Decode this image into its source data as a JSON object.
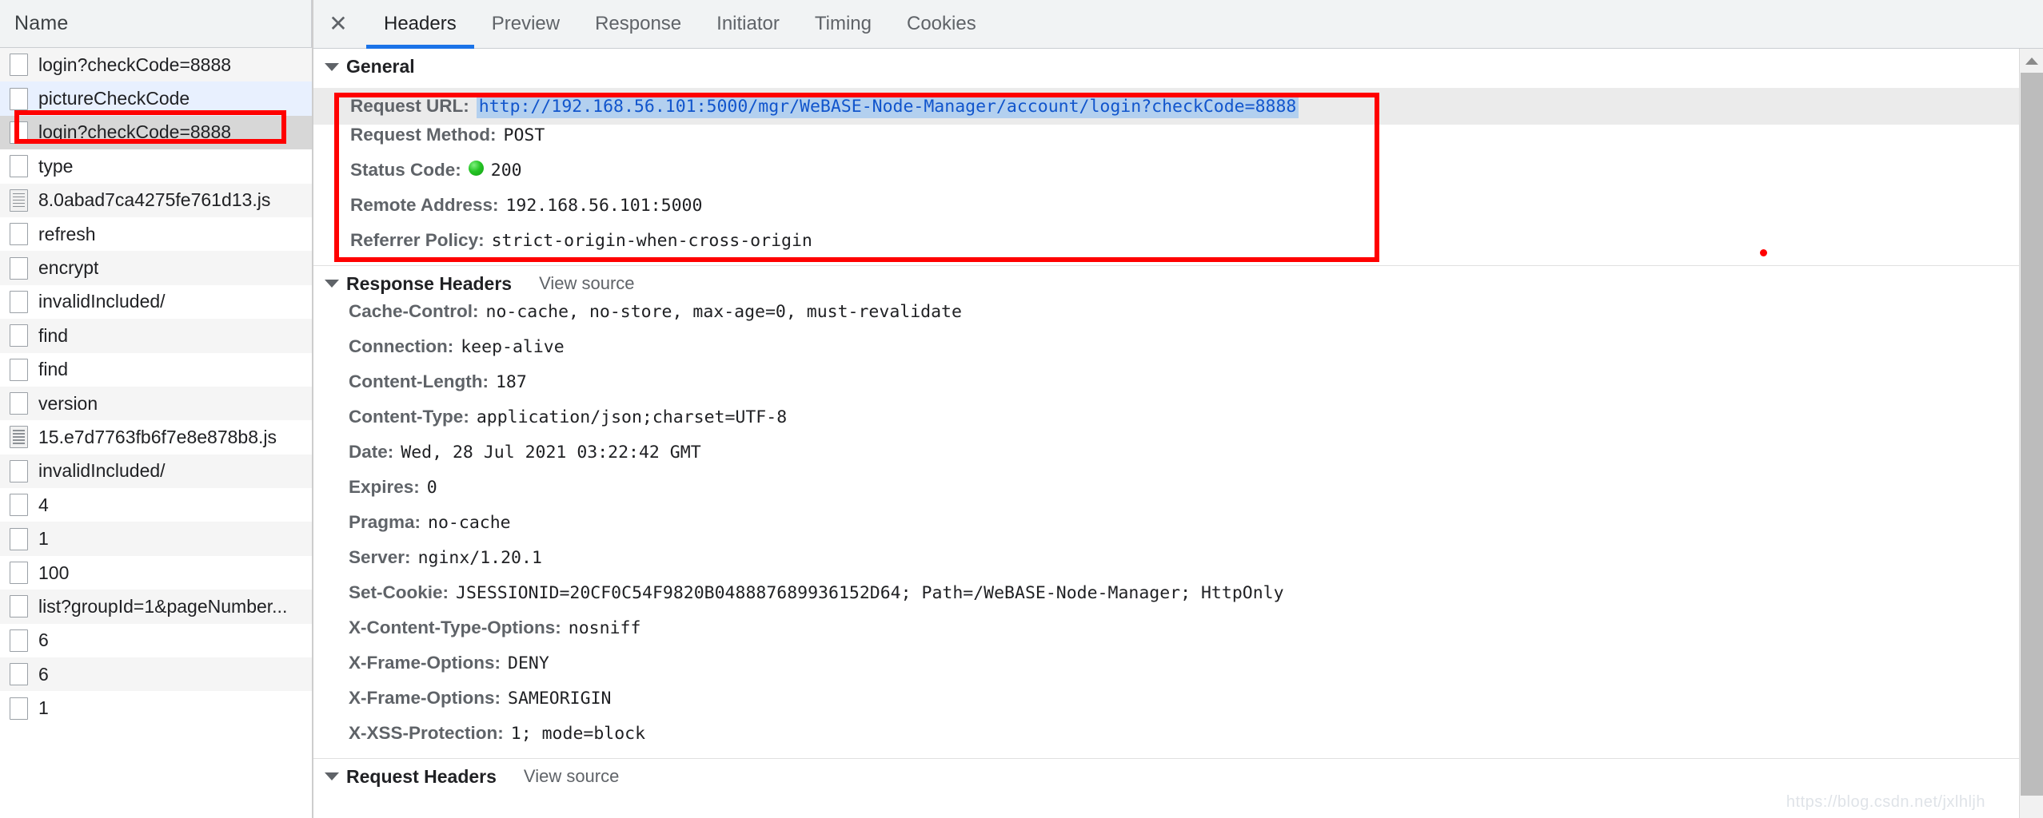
{
  "panel_left": {
    "column_header": "Name",
    "requests": [
      {
        "label": "login?checkCode=8888",
        "icon": "request-icon",
        "row_style": "odd"
      },
      {
        "label": "pictureCheckCode",
        "icon": "request-icon",
        "row_style": "sel-blue"
      },
      {
        "label": "login?checkCode=8888",
        "icon": "request-icon",
        "row_style": "sel-gray"
      },
      {
        "label": "type",
        "icon": "request-icon",
        "row_style": "even"
      },
      {
        "label": "8.0abad7ca4275fe761d13.js",
        "icon": "script-file-icon",
        "row_style": "odd"
      },
      {
        "label": "refresh",
        "icon": "request-icon",
        "row_style": "even"
      },
      {
        "label": "encrypt",
        "icon": "request-icon",
        "row_style": "odd"
      },
      {
        "label": "invalidIncluded/",
        "icon": "request-icon",
        "row_style": "even"
      },
      {
        "label": "find",
        "icon": "request-icon",
        "row_style": "odd"
      },
      {
        "label": "find",
        "icon": "request-icon",
        "row_style": "even"
      },
      {
        "label": "version",
        "icon": "request-icon",
        "row_style": "odd"
      },
      {
        "label": "15.e7d7763fb6f7e8e878b8.js",
        "icon": "script-file-icon",
        "row_style": "even"
      },
      {
        "label": "invalidIncluded/",
        "icon": "request-icon",
        "row_style": "odd"
      },
      {
        "label": "4",
        "icon": "request-icon",
        "row_style": "even"
      },
      {
        "label": "1",
        "icon": "request-icon",
        "row_style": "odd"
      },
      {
        "label": "100",
        "icon": "request-icon",
        "row_style": "even"
      },
      {
        "label": "list?groupId=1&pageNumber...",
        "icon": "request-icon",
        "row_style": "odd"
      },
      {
        "label": "6",
        "icon": "request-icon",
        "row_style": "even"
      },
      {
        "label": "6",
        "icon": "request-icon",
        "row_style": "odd"
      },
      {
        "label": "1",
        "icon": "request-icon",
        "row_style": "even"
      }
    ]
  },
  "tabbar": {
    "close_label": "✕",
    "tabs": [
      {
        "label": "Headers",
        "active": true
      },
      {
        "label": "Preview",
        "active": false
      },
      {
        "label": "Response",
        "active": false
      },
      {
        "label": "Initiator",
        "active": false
      },
      {
        "label": "Timing",
        "active": false
      },
      {
        "label": "Cookies",
        "active": false
      }
    ]
  },
  "sections": {
    "general": {
      "title": "General",
      "rows": [
        {
          "key": "Request URL:",
          "value": "http://192.168.56.101:5000/mgr/WeBASE-Node-Manager/account/login?checkCode=8888",
          "is_link": true
        },
        {
          "key": "Request Method:",
          "value": "POST",
          "is_link": false
        },
        {
          "key": "Status Code:",
          "value": "200",
          "is_link": false,
          "status_dot": true
        },
        {
          "key": "Remote Address:",
          "value": "192.168.56.101:5000",
          "is_link": false
        },
        {
          "key": "Referrer Policy:",
          "value": "strict-origin-when-cross-origin",
          "is_link": false
        }
      ]
    },
    "response_headers": {
      "title": "Response Headers",
      "view_source": "View source",
      "rows": [
        {
          "key": "Cache-Control:",
          "value": "no-cache, no-store, max-age=0, must-revalidate"
        },
        {
          "key": "Connection:",
          "value": "keep-alive"
        },
        {
          "key": "Content-Length:",
          "value": "187"
        },
        {
          "key": "Content-Type:",
          "value": "application/json;charset=UTF-8"
        },
        {
          "key": "Date:",
          "value": "Wed, 28 Jul 2021 03:22:42 GMT"
        },
        {
          "key": "Expires:",
          "value": "0"
        },
        {
          "key": "Pragma:",
          "value": "no-cache"
        },
        {
          "key": "Server:",
          "value": "nginx/1.20.1"
        },
        {
          "key": "Set-Cookie:",
          "value": "JSESSIONID=20CF0C54F9820B048887689936152D64; Path=/WeBASE-Node-Manager; HttpOnly"
        },
        {
          "key": "X-Content-Type-Options:",
          "value": "nosniff"
        },
        {
          "key": "X-Frame-Options:",
          "value": "DENY"
        },
        {
          "key": "X-Frame-Options:",
          "value": "SAMEORIGIN"
        },
        {
          "key": "X-XSS-Protection:",
          "value": "1; mode=block"
        }
      ]
    },
    "request_headers": {
      "title": "Request Headers",
      "view_source": "View source"
    }
  },
  "annotations": {
    "highlight_color": "#ff0000",
    "accent_color": "#1a73e8",
    "link_color": "#1155cc",
    "status_ok_color": "#25c425"
  },
  "watermark": "https://blog.csdn.net/jxlhljh"
}
